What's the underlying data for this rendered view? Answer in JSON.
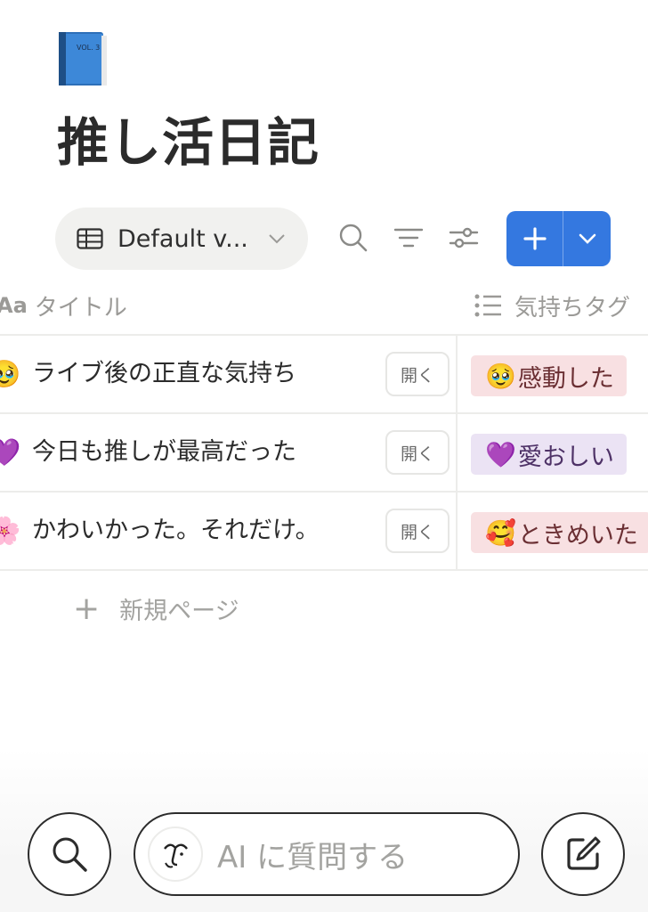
{
  "page": {
    "icon": "blue-book-icon",
    "icon_label": "VOL. 3",
    "title": "推し活日記"
  },
  "toolbar": {
    "view_label": "Default v...",
    "view_icon": "table-icon",
    "icons": [
      "search-icon",
      "filter-icon",
      "settings-sliders-icon"
    ],
    "new_button": {
      "icon": "plus-icon",
      "dropdown_icon": "chevron-down-icon",
      "color": "#3478e0"
    }
  },
  "columns": {
    "title": {
      "prefix": "Aa",
      "label": "タイトル"
    },
    "tag": {
      "icon": "list-icon",
      "label": "気持ちタグ"
    }
  },
  "rows": [
    {
      "left_emoji": "🥹",
      "title": "ライブ後の正直な気持ち",
      "open_label": "開く",
      "tag": {
        "emoji": "🥹",
        "text": "感動した",
        "bg": "#f8e0e2",
        "color": "#6b2f33"
      }
    },
    {
      "left_emoji": "💜",
      "title": "今日も推しが最高だった",
      "open_label": "開く",
      "tag": {
        "emoji": "💜",
        "text": "愛おしい",
        "bg": "#ebe3f4",
        "color": "#4e3267"
      }
    },
    {
      "left_emoji": "🌸",
      "title": "かわいかった。それだけ。",
      "open_label": "開く",
      "tag": {
        "emoji": "🥰",
        "text": "ときめいた",
        "bg": "#f8e0e2",
        "color": "#6b2f33"
      }
    }
  ],
  "new_page_label": "新規ページ",
  "bottom_bar": {
    "search_icon": "search-icon",
    "ai_placeholder": "AI に質問する",
    "ai_avatar": "ai-face-icon",
    "compose_icon": "compose-icon"
  }
}
